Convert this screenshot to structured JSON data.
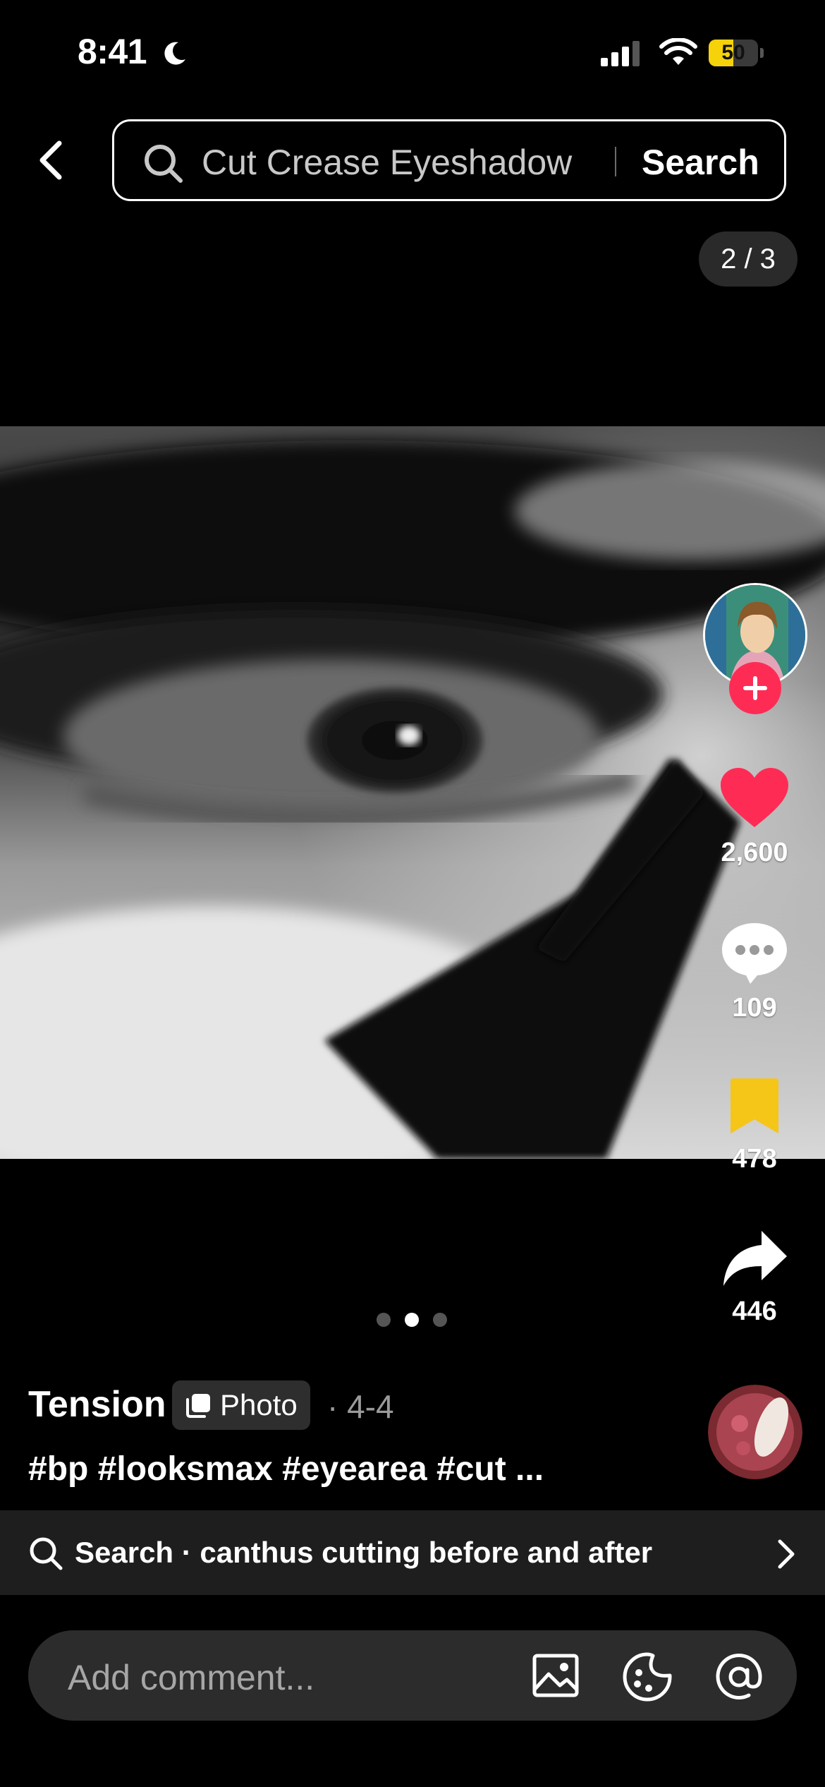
{
  "status_bar": {
    "time": "8:41",
    "battery": "50",
    "battery_level": 0.5
  },
  "search": {
    "query": "Cut Crease Eyeshadow",
    "button_label": "Search"
  },
  "page_counter": "2 / 3",
  "carousel": {
    "total": 3,
    "current": 2
  },
  "actions": {
    "likes": "2,600",
    "comments": "109",
    "saves": "478",
    "shares": "446"
  },
  "post": {
    "author": "Tension",
    "type_badge": "Photo",
    "date": "· 4-4",
    "caption": "#bp #looksmax #eyearea #cut ..."
  },
  "search_suggestion": {
    "text": "Search · canthus cutting before and after"
  },
  "comment": {
    "placeholder": "Add comment..."
  },
  "colors": {
    "like": "#fe2c55",
    "save": "#f5c518",
    "battery": "#f5d20a",
    "follow": "#fe2c55"
  },
  "icons": [
    "moon-icon",
    "signal-icon",
    "wifi-icon",
    "back-icon",
    "search-icon",
    "heart-icon",
    "comment-icon",
    "bookmark-icon",
    "share-icon",
    "image-icon",
    "sticker-icon",
    "at-icon",
    "chevron-right-icon",
    "plus-icon"
  ]
}
